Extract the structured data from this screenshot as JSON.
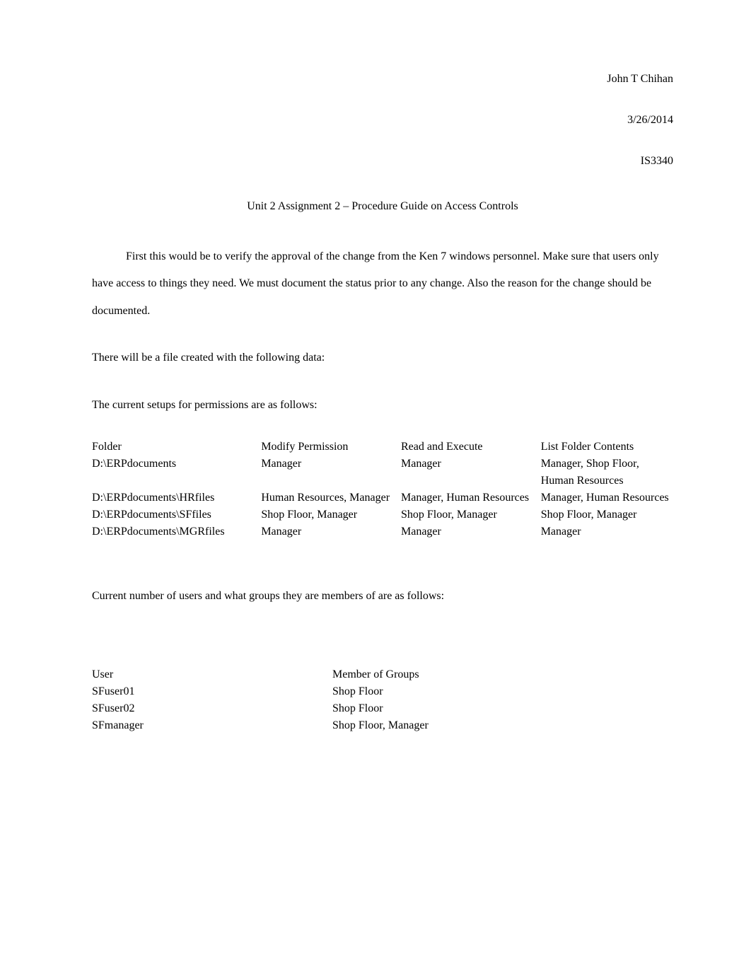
{
  "header": {
    "author": "John T Chihan",
    "date": "3/26/2014",
    "course": "IS3340"
  },
  "title": "Unit 2 Assignment 2 – Procedure Guide on Access Controls",
  "paragraphs": {
    "intro": "First this would be to verify the approval of the change from the Ken 7 windows personnel. Make sure that users only have access to things they need. We must document the status prior to any change. Also the reason for the change should be documented.",
    "file_created": "There will be a file created with the following data:",
    "current_setups": "The current setups for permissions are as follows:",
    "current_users": "Current number of users and what groups they are members of are as follows:"
  },
  "permissions_table": {
    "headers": {
      "folder": "Folder",
      "modify": "Modify Permission",
      "read": "Read and Execute",
      "list": "List Folder Contents"
    },
    "rows": [
      {
        "folder": "D:\\ERPdocuments",
        "modify": "Manager",
        "read": "Manager",
        "list": "Manager, Shop Floor, Human Resources"
      },
      {
        "folder": "D:\\ERPdocuments\\HRfiles",
        "modify": "Human Resources, Manager",
        "read": "Manager, Human Resources",
        "list": "Manager, Human Resources"
      },
      {
        "folder": "D:\\ERPdocuments\\SFfiles",
        "modify": "Shop Floor, Manager",
        "read": "Shop Floor, Manager",
        "list": "Shop Floor, Manager"
      },
      {
        "folder": "D:\\ERPdocuments\\MGRfiles",
        "modify": "Manager",
        "read": "Manager",
        "list": "Manager"
      }
    ]
  },
  "users_table": {
    "headers": {
      "user": "User",
      "groups": "Member of Groups"
    },
    "rows": [
      {
        "user": "SFuser01",
        "groups": "Shop Floor"
      },
      {
        "user": "SFuser02",
        "groups": "Shop Floor"
      },
      {
        "user": "SFmanager",
        "groups": "Shop Floor, Manager"
      }
    ]
  }
}
